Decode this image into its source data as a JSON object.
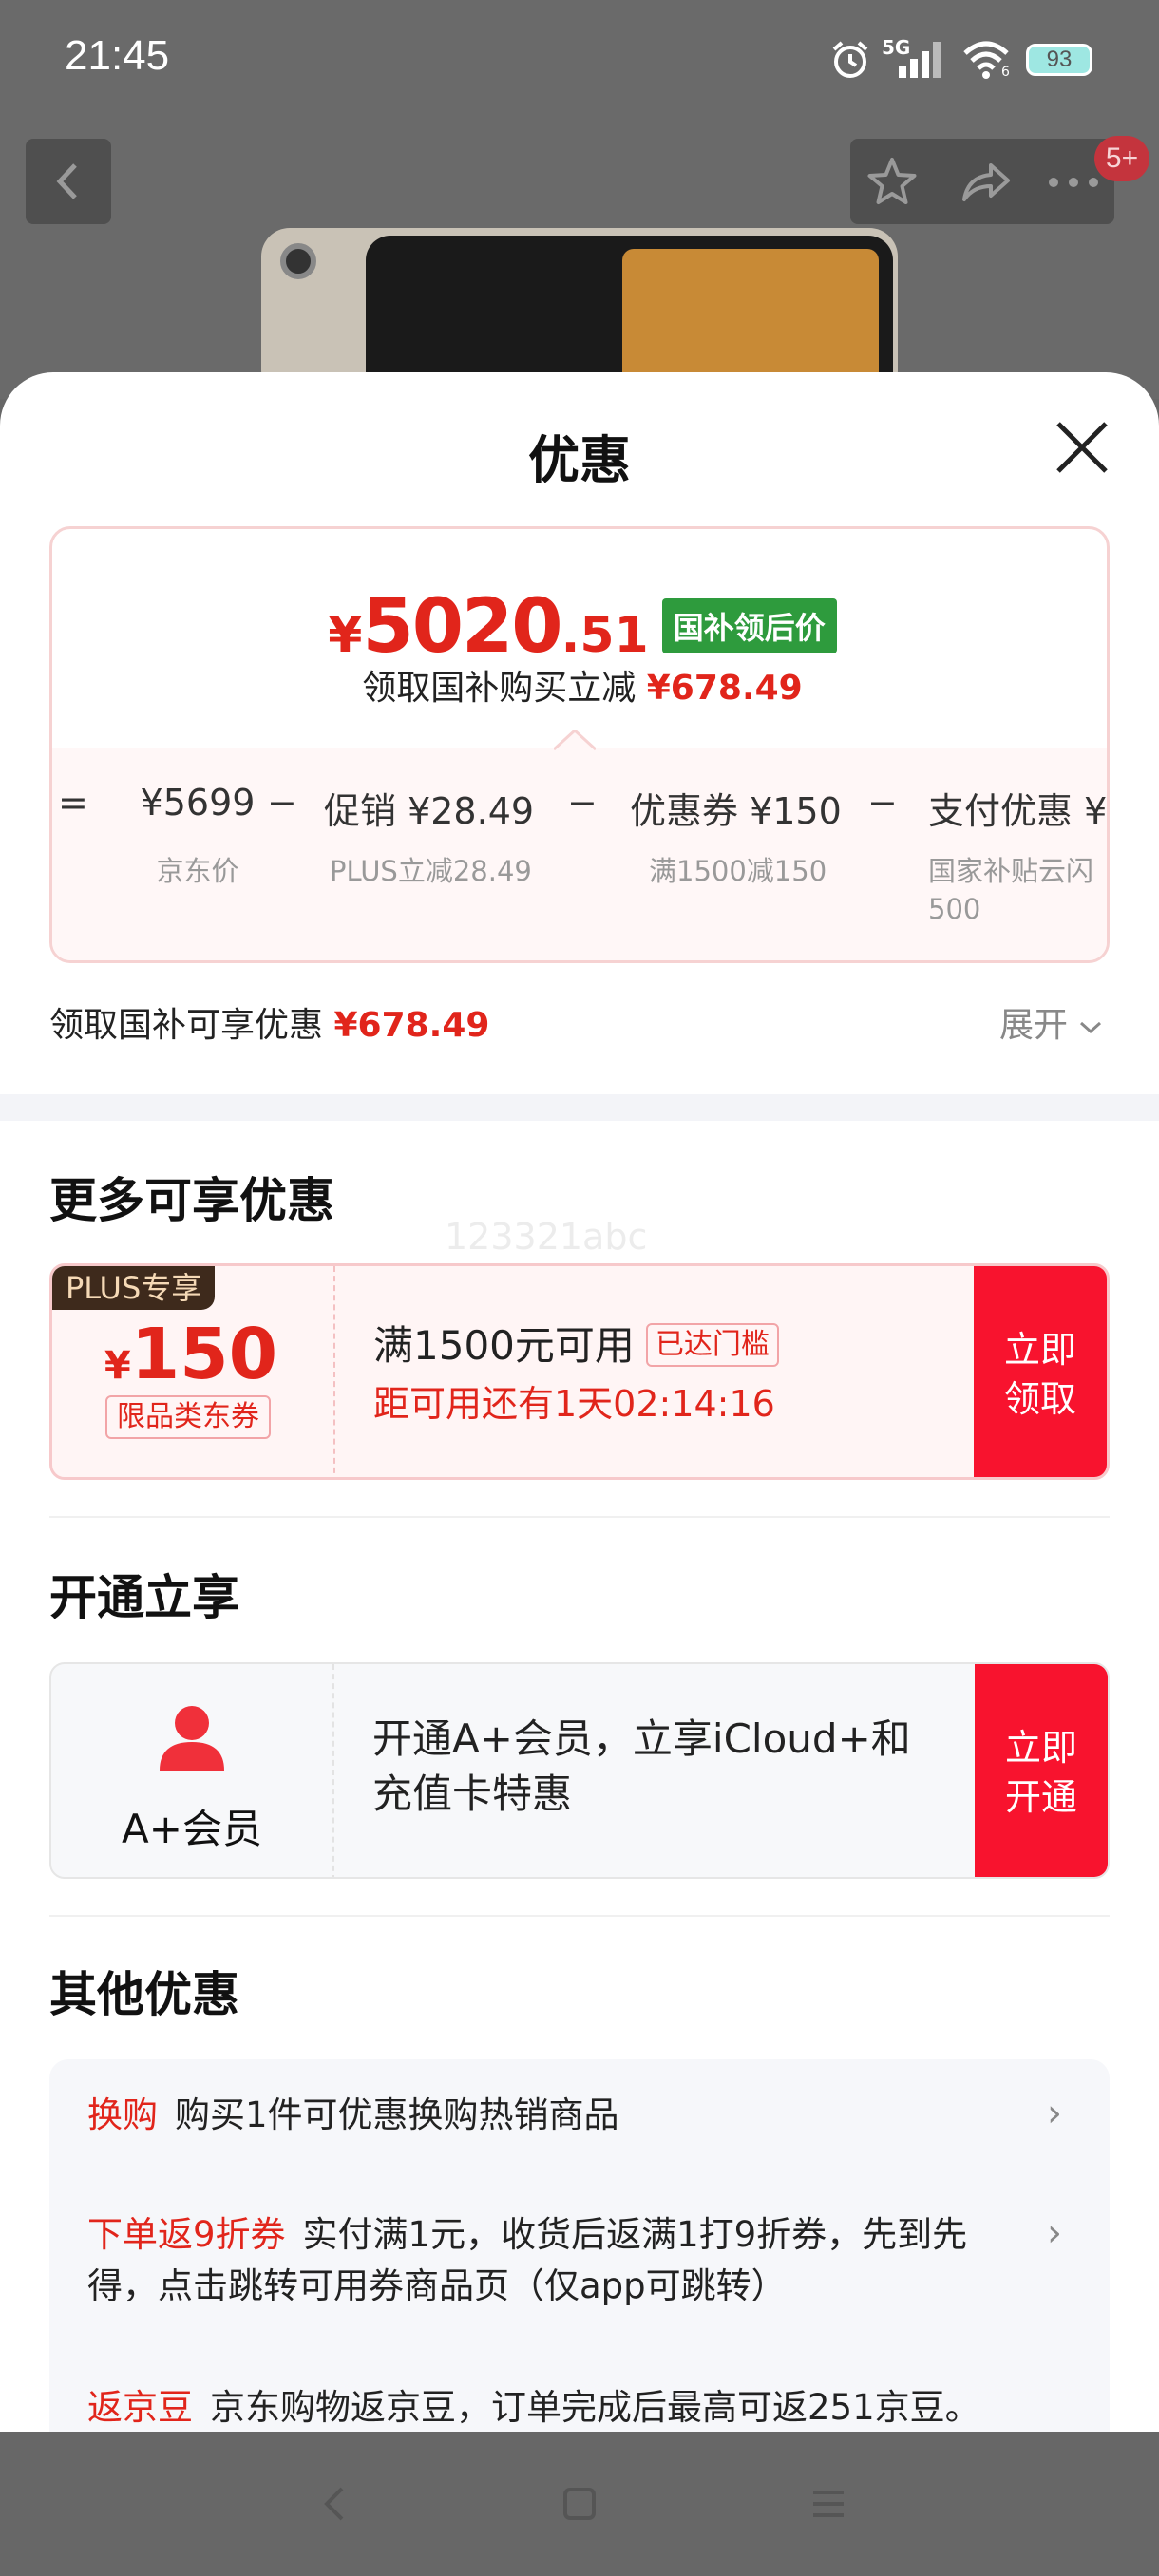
{
  "status_bar": {
    "time": "21:45",
    "network": "5G",
    "wifi_label": "6",
    "battery": "93"
  },
  "top_nav": {
    "badge": "5+"
  },
  "sheet": {
    "title": "优惠",
    "price": {
      "yen": "¥",
      "integer": "5020",
      "decimal": ".51",
      "tag": "国补领后价"
    },
    "subtitle": {
      "label": "领取国补购买立减",
      "amount": "¥678.49"
    },
    "breakdown": [
      {
        "op": "=",
        "value": "",
        "label": ""
      },
      {
        "op": "",
        "value": "¥5699",
        "label": "京东价"
      },
      {
        "op": "−",
        "value": "",
        "label": ""
      },
      {
        "op": "",
        "value": "促销 ¥28.49",
        "label": "PLUS立减28.49"
      },
      {
        "op": "−",
        "value": "",
        "label": ""
      },
      {
        "op": "",
        "value": "优惠券 ¥150",
        "label": "满1500减150"
      },
      {
        "op": "−",
        "value": "",
        "label": ""
      },
      {
        "op": "",
        "value": "支付优惠 ¥",
        "label": "国家补贴云闪 500"
      }
    ],
    "receive": {
      "label": "领取国补可享优惠",
      "amount": "¥678.49",
      "expand": "展开"
    },
    "more_section": {
      "title": "更多可享优惠",
      "watermark": "123321abc",
      "coupon": {
        "plus_tag": "PLUS专享",
        "yen": "¥",
        "amount": "150",
        "kind": "限品类东券",
        "condition": "满1500元可用",
        "reached": "已达门槛",
        "countdown": "距可用还有1天02:14:16",
        "button": "立即领取"
      }
    },
    "open_section": {
      "title": "开通立享",
      "member": {
        "label": "A+会员",
        "desc": "开通A+会员，立享iCloud+和充值卡特惠",
        "button": "立即开通"
      }
    },
    "other_section": {
      "title": "其他优惠",
      "items": [
        {
          "tag": "换购",
          "text": "购买1件可优惠换购热销商品"
        },
        {
          "tag": "下单返9折券",
          "text": "实付满1元，收货后返满1打9折券，先到先得，点击跳转可用券商品页（仅app可跳转）"
        },
        {
          "tag": "返京豆",
          "text": "京东购物返京豆，订单完成后最高可返251京豆。"
        }
      ]
    }
  },
  "colors": {
    "accent": "#e1251b",
    "button": "#f8132e",
    "national_tag": "#2e9b3d"
  }
}
